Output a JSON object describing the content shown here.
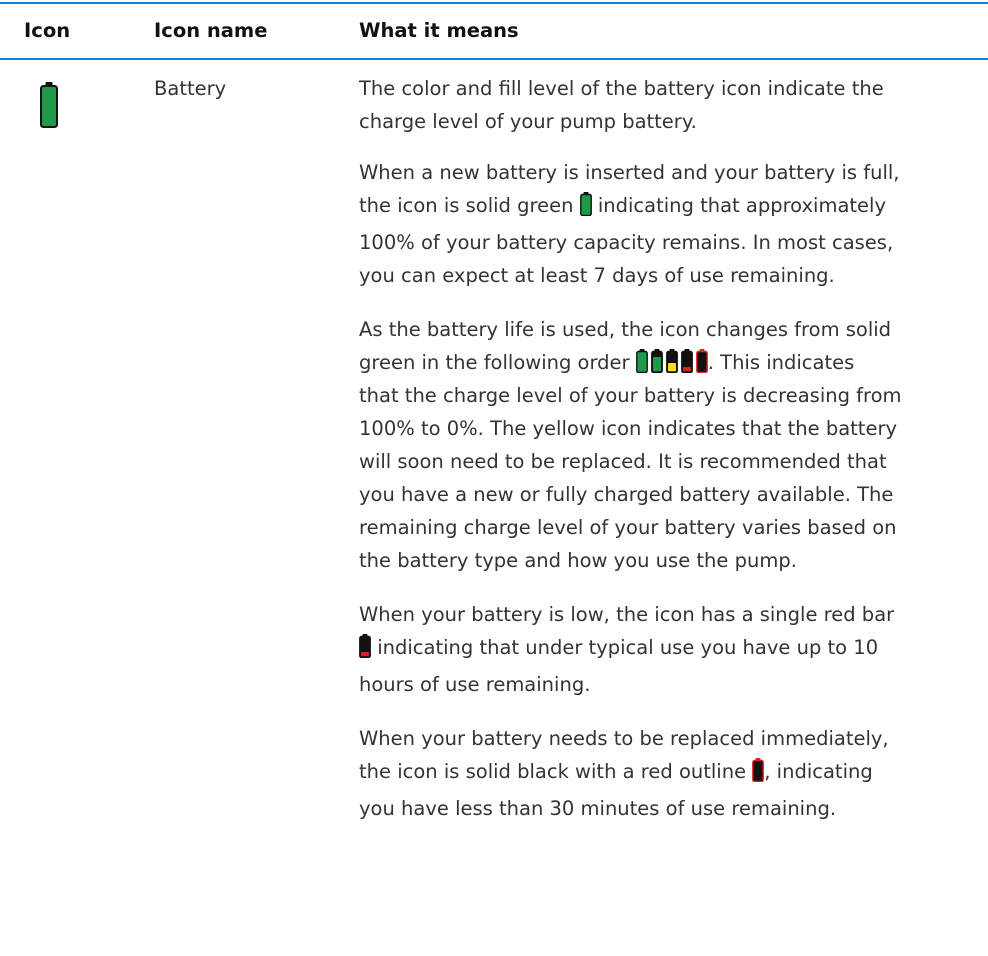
{
  "table": {
    "headers": [
      "Icon",
      "Icon name",
      "What it means"
    ],
    "row": {
      "icon": "battery-full-icon",
      "name": "Battery",
      "paragraphs": [
        {
          "lines": [
            "The color and fill level of the battery icon indicate the",
            "charge level of your pump battery."
          ]
        },
        {
          "lines": [
            "When a new battery is inserted and your battery is full,",
            [
              "the icon is solid green ",
              "battery-full-inline-icon",
              " indicating that approximately"
            ],
            "100% of your battery capacity remains. In most cases,",
            "you can expect at least 7 days of use remaining."
          ]
        },
        {
          "lines": [
            "As the battery life is used, the icon changes from solid",
            [
              "green in the following order ",
              "battery-sequence-icons",
              ". This indicates"
            ],
            "that the charge level of your battery is decreasing from",
            "100% to 0%. The yellow icon indicates that the battery",
            "will soon need to be replaced. It is recommended that",
            "you have a new or fully charged battery available. The",
            "remaining charge level of your battery varies based on",
            "the battery type and how you use the pump."
          ]
        },
        {
          "lines": [
            "When your battery is low, the icon has a single red bar",
            [
              "",
              "battery-low-inline-icon",
              " indicating that under typical use you have up to 10"
            ],
            "hours of use remaining."
          ]
        },
        {
          "lines": [
            "When your battery needs to be replaced immediately,",
            [
              "the icon is solid black with a red outline ",
              "battery-empty-inline-icon",
              ", indicating"
            ],
            "you have less than 30 minutes of use remaining."
          ]
        }
      ]
    }
  },
  "colors": {
    "rule": "#1e7fd2",
    "battery_green": "#1f9a49",
    "battery_yellow": "#f2e600",
    "battery_red": "#e02020",
    "battery_black": "#111111"
  }
}
